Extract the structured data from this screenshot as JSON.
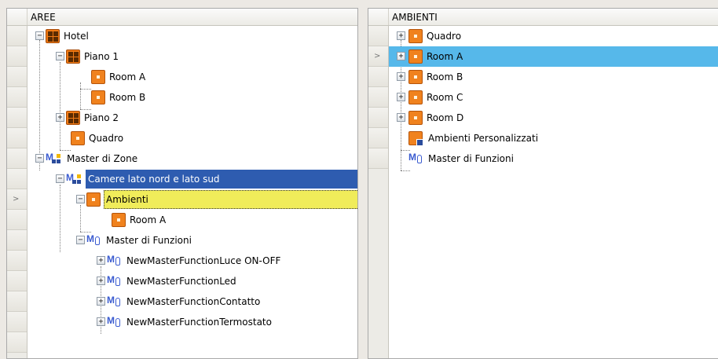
{
  "left_panel": {
    "title": "AREE",
    "selected_marker": ">",
    "rows": [
      {
        "label": "Hotel"
      },
      {
        "label": "Piano 1"
      },
      {
        "label": "Room A"
      },
      {
        "label": "Room B"
      },
      {
        "label": "Piano 2"
      },
      {
        "label": "Quadro"
      },
      {
        "label": "Master di Zone"
      },
      {
        "label": "Camere lato nord e lato sud"
      },
      {
        "label": "Ambienti"
      },
      {
        "label": "Room A"
      },
      {
        "label": "Master di Funzioni"
      },
      {
        "label": "NewMasterFunctionLuce ON-OFF"
      },
      {
        "label": "NewMasterFunctionLed"
      },
      {
        "label": "NewMasterFunctionContatto"
      },
      {
        "label": "NewMasterFunctionTermostato"
      }
    ]
  },
  "right_panel": {
    "title": "AMBIENTI",
    "selected_marker": ">",
    "rows": [
      {
        "label": "Quadro"
      },
      {
        "label": "Room A"
      },
      {
        "label": "Room B"
      },
      {
        "label": "Room C"
      },
      {
        "label": "Room D"
      },
      {
        "label": "Ambienti Personalizzati"
      },
      {
        "label": "Master di Funzioni"
      }
    ]
  },
  "expanders": {
    "plus": "+",
    "minus": "−"
  },
  "colors": {
    "selection_blue": "#2e5cb0",
    "selection_yellow": "#f0ec5a",
    "selection_light_blue": "#56b8ea",
    "icon_orange": "#f0821e",
    "master_blue": "#3a5bd0"
  }
}
